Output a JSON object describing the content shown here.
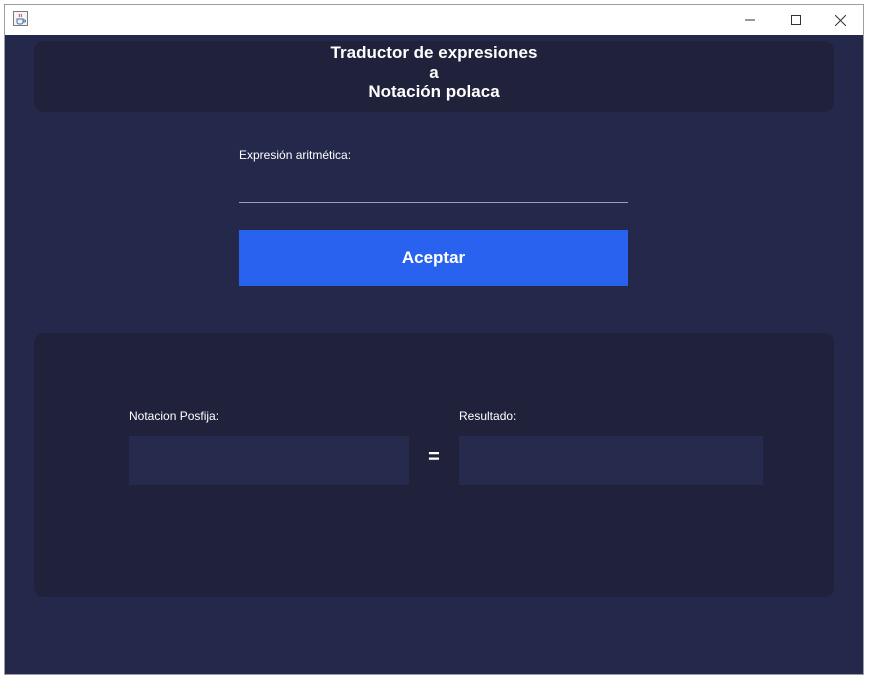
{
  "window": {
    "app_icon": "java-cup-icon",
    "controls": {
      "minimize_icon": "minimize-icon",
      "maximize_icon": "maximize-icon",
      "close_icon": "close-icon"
    }
  },
  "header": {
    "title_line1": "Traductor de expresiones",
    "title_line2": "a",
    "title_line3": "Notación polaca"
  },
  "form": {
    "expression_label": "Expresión aritmética:",
    "expression_value": "",
    "accept_label": "Aceptar"
  },
  "results": {
    "postfix_label": "Notacion Posfija:",
    "postfix_value": "",
    "equals": "=",
    "result_label": "Resultado:",
    "result_value": ""
  },
  "colors": {
    "background": "#24284b",
    "panel": "#20223c",
    "button": "#2962ef",
    "field": "#262a4d",
    "text": "#ffffff"
  }
}
